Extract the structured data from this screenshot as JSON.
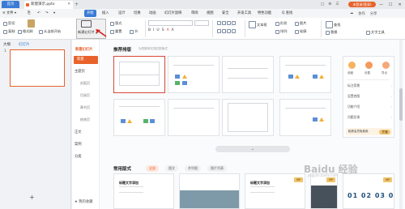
{
  "titlebar": {
    "home_tab": "首页",
    "doc_tab": "新建演示.pptx",
    "new_tab": "+",
    "login": "未登录(登录)",
    "icons": [
      "□",
      "⚙",
      "☰"
    ],
    "win_controls": [
      "—",
      "☐",
      "✕"
    ]
  },
  "menu": {
    "file": "≡ 文件 ▾",
    "quick": [
      "⎘",
      "↶",
      "↷",
      "▾"
    ],
    "items": [
      "开始",
      "插入",
      "设计",
      "切换",
      "动画",
      "幻灯片放映",
      "审阅",
      "视图",
      "安全",
      "开发工具",
      "特色功能"
    ],
    "search": "Q 查找",
    "right": [
      "☁",
      "协作",
      "分享"
    ]
  },
  "ribbon": {
    "cut": "剪切",
    "copy": "复制",
    "format_painter": "格式刷",
    "paste": "粘贴",
    "from_current": "从当前开始",
    "new_slide": "新建幻灯片",
    "layout": "版式",
    "reset": "重置",
    "section": "节",
    "font_placeholder": "",
    "text_box": "文本框",
    "shape": "形状",
    "arrange": "排列",
    "picture": "图片",
    "find": "查找",
    "replace": "替换",
    "outline": "轮廓",
    "text_tools": "文字工具",
    "fmt": [
      "B",
      "I",
      "U",
      "S",
      "A",
      "A"
    ]
  },
  "leftpanel": {
    "tabs": [
      "大纲",
      "幻灯片"
    ],
    "slide_number": "1",
    "add": "+"
  },
  "dialog": {
    "logo": "新建幻灯片",
    "new_btn": "新建",
    "nav": [
      "主题页",
      "封面页",
      "目录页",
      "章节页",
      "结束页",
      "正文",
      "案例",
      "分类"
    ],
    "bottom": "★ 我的收藏",
    "rec_title": "推荐排版",
    "rec_sub": "为您推荐文档匹配版式",
    "expand": "⌄",
    "common_title": "常用版式",
    "filters": [
      "全部",
      "图文",
      "并列图",
      "图片列表"
    ],
    "rp_icons": [
      "收藏",
      "设置",
      "导出"
    ],
    "rp_items": [
      "标注背景",
      "设置底图",
      "功能介绍",
      "问题反馈"
    ],
    "rp_bottom": "稻壳会员免费用",
    "rp_btn": "开通",
    "card_title_1": "标题文字添加",
    "card_title_2": "标题文字添加",
    "vip": "VIP",
    "nums": "01 02 03 04"
  },
  "watermark": "Baidu 经验",
  "watermark_sub": "jingyan.baidu.com",
  "colors": {
    "accent": "#e8632b",
    "menu_active": "#3a7bd5",
    "selected_border": "#d84a3a"
  }
}
